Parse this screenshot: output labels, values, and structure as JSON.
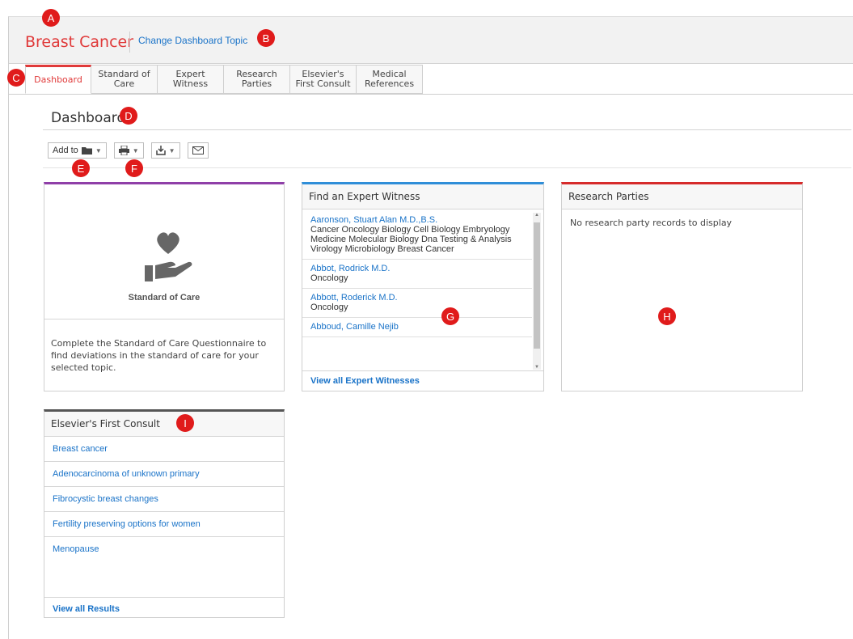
{
  "header": {
    "topic_title": "Breast Cancer",
    "change_topic_link": "Change Dashboard Topic"
  },
  "tabs": [
    {
      "label": "Dashboard",
      "active": true
    },
    {
      "label": "Standard of\nCare",
      "active": false
    },
    {
      "label": "Expert\nWitness",
      "active": false
    },
    {
      "label": "Research\nParties",
      "active": false
    },
    {
      "label": "Elsevier's\nFirst Consult",
      "active": false
    },
    {
      "label": "Medical\nReferences",
      "active": false
    }
  ],
  "page_title": "Dashboard",
  "toolbar": {
    "add_to_label": "Add to",
    "icons": [
      "folder-icon",
      "print-icon",
      "download-icon",
      "email-icon"
    ]
  },
  "standard_of_care": {
    "label": "Standard of Care",
    "description": "Complete the Standard of Care Questionnaire to find deviations in the standard of care for your selected topic."
  },
  "expert_witness": {
    "title": "Find an Expert Witness",
    "items": [
      {
        "name": "Aaronson, Stuart Alan M.D.,B.S.",
        "specialty": "Cancer Oncology Biology Cell Biology Embryology Medicine Molecular Biology Dna Testing & Analysis Virology Microbiology Breast Cancer"
      },
      {
        "name": "Abbot, Rodrick M.D.",
        "specialty": "Oncology"
      },
      {
        "name": "Abbott, Roderick M.D.",
        "specialty": "Oncology"
      },
      {
        "name": "Abboud, Camille Nejib",
        "specialty": ""
      }
    ],
    "view_all": "View all Expert Witnesses"
  },
  "research_parties": {
    "title": "Research Parties",
    "empty_message": "No research party records to display"
  },
  "first_consult": {
    "title": "Elsevier's First Consult",
    "items": [
      "Breast cancer",
      "Adenocarcinoma of unknown primary",
      "Fibrocystic breast changes",
      "Fertility preserving options for women",
      "Menopause"
    ],
    "view_all": "View all Results"
  },
  "callouts": [
    "A",
    "B",
    "C",
    "D",
    "E",
    "F",
    "G",
    "H",
    "I"
  ],
  "colors": {
    "accent_red": "#e03a3a",
    "link_blue": "#1a73c8",
    "soc_border": "#8f3fa8",
    "expert_border": "#2f8ed8",
    "research_border": "#d62b2b",
    "callout_red": "#e01b1b"
  }
}
